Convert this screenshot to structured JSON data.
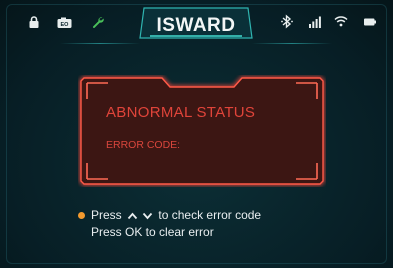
{
  "status_bar": {
    "title": "ISWARD",
    "left_icons": [
      "lock-icon",
      "camera-icon",
      "wrench-icon"
    ],
    "right_icons": [
      "bluetooth-icon",
      "signal-icon",
      "wifi-icon",
      "battery-icon"
    ]
  },
  "alert": {
    "title": "ABNORMAL STATUS",
    "error_code_label": "ERROR CODE:"
  },
  "hints": {
    "line1_before": "Press",
    "line1_after": "to check error code",
    "line2": "Press OK to clear error",
    "nav_icons": [
      "chevron-up-icon",
      "chevron-down-icon"
    ]
  },
  "colors": {
    "background": "#08232b",
    "accent_teal": "#2fb4b0",
    "alert_red": "#e0443a",
    "bullet_orange": "#f39a2e",
    "text_light": "#e9eef0"
  }
}
